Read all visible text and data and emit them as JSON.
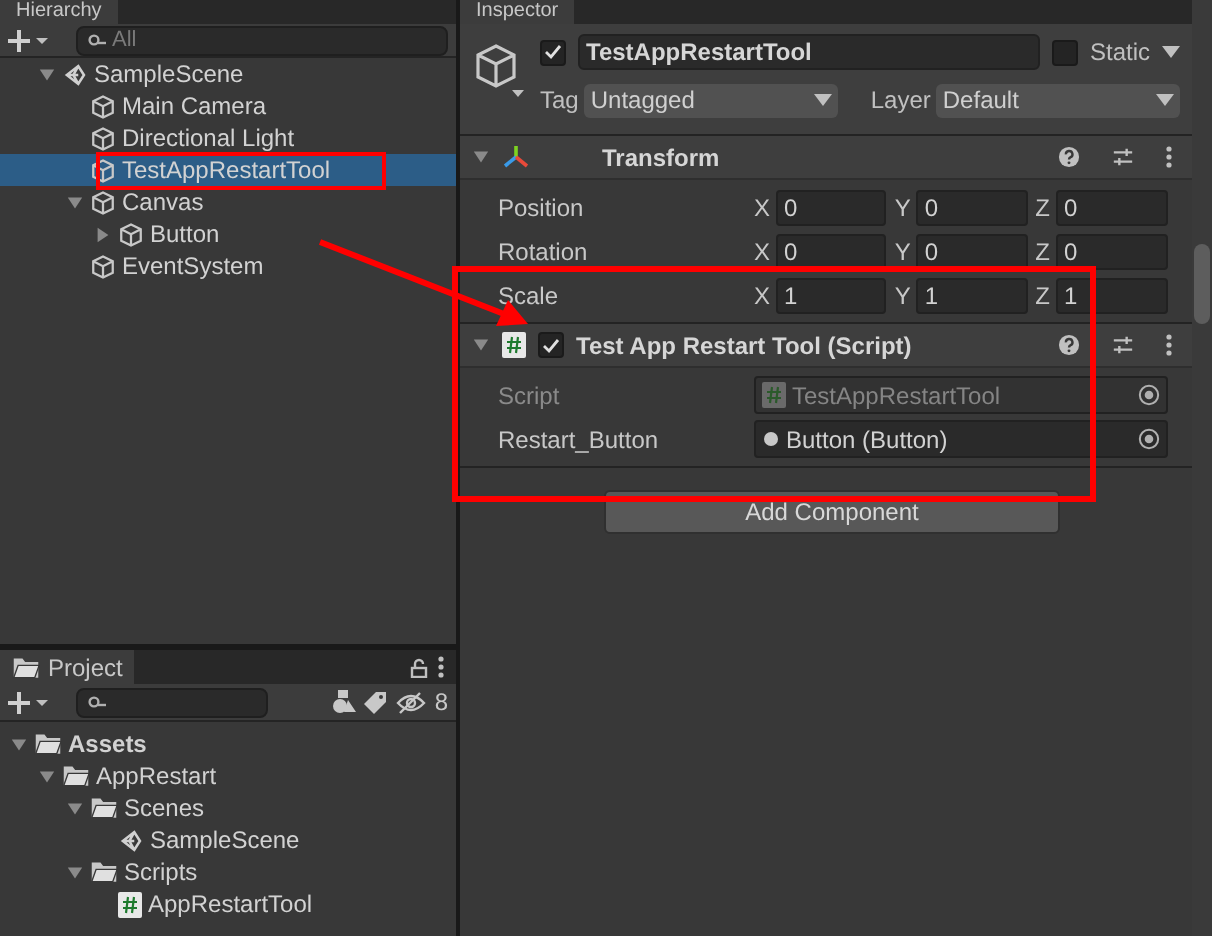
{
  "hierarchy": {
    "title": "Hierarchy",
    "search": {
      "placeholder": "All"
    },
    "tree": [
      {
        "label": "SampleScene",
        "kind": "scene",
        "expanded": true,
        "selected": false,
        "children": [
          {
            "label": "Main Camera",
            "kind": "gameobject",
            "selected": false
          },
          {
            "label": "Directional Light",
            "kind": "gameobject",
            "selected": false
          },
          {
            "label": "TestAppRestartTool",
            "kind": "gameobject",
            "selected": true
          },
          {
            "label": "Canvas",
            "kind": "gameobject",
            "expanded": true,
            "selected": false,
            "children": [
              {
                "label": "Button",
                "kind": "gameobject",
                "expanded": false,
                "selected": false
              }
            ]
          },
          {
            "label": "EventSystem",
            "kind": "gameobject",
            "selected": false
          }
        ]
      }
    ]
  },
  "project": {
    "title": "Project",
    "hidden_count": "8",
    "tree": [
      {
        "label": "Assets",
        "kind": "folder",
        "bold": true,
        "expanded": true,
        "selected": false,
        "children": [
          {
            "label": "AppRestart",
            "kind": "folder",
            "expanded": true,
            "selected": false,
            "children": [
              {
                "label": "Scenes",
                "kind": "folder",
                "expanded": true,
                "selected": false,
                "children": [
                  {
                    "label": "SampleScene",
                    "kind": "scene",
                    "selected": false
                  }
                ]
              },
              {
                "label": "Scripts",
                "kind": "folder",
                "expanded": true,
                "selected": false,
                "children": [
                  {
                    "label": "AppRestartTool",
                    "kind": "script",
                    "selected": false
                  }
                ]
              }
            ]
          }
        ]
      }
    ]
  },
  "inspector": {
    "title": "Inspector",
    "active": true,
    "name": "TestAppRestartTool",
    "static": false,
    "static_label": "Static",
    "tag_label": "Tag",
    "tag": "Untagged",
    "layer_label": "Layer",
    "layer": "Default",
    "components": [
      {
        "kind": "transform",
        "title": "Transform",
        "expanded": true,
        "rows": [
          {
            "kind": "vector",
            "label": "Position",
            "fields": [
              {
                "axis": "X",
                "value": "0"
              },
              {
                "axis": "Y",
                "value": "0"
              },
              {
                "axis": "Z",
                "value": "0"
              }
            ]
          },
          {
            "kind": "vector",
            "label": "Rotation",
            "fields": [
              {
                "axis": "X",
                "value": "0"
              },
              {
                "axis": "Y",
                "value": "0"
              },
              {
                "axis": "Z",
                "value": "0"
              }
            ]
          },
          {
            "kind": "vector",
            "label": "Scale",
            "fields": [
              {
                "axis": "X",
                "value": "1"
              },
              {
                "axis": "Y",
                "value": "1"
              },
              {
                "axis": "Z",
                "value": "1"
              }
            ]
          }
        ]
      },
      {
        "kind": "script",
        "title": "Test App Restart Tool (Script)",
        "enabled": true,
        "expanded": true,
        "rows": [
          {
            "kind": "script",
            "label": "Script",
            "value": "TestAppRestartTool",
            "disabled": true
          },
          {
            "kind": "object",
            "label": "Restart_Button",
            "value": "Button (Button)",
            "disabled": false
          }
        ]
      }
    ],
    "add_component": "Add Component"
  }
}
